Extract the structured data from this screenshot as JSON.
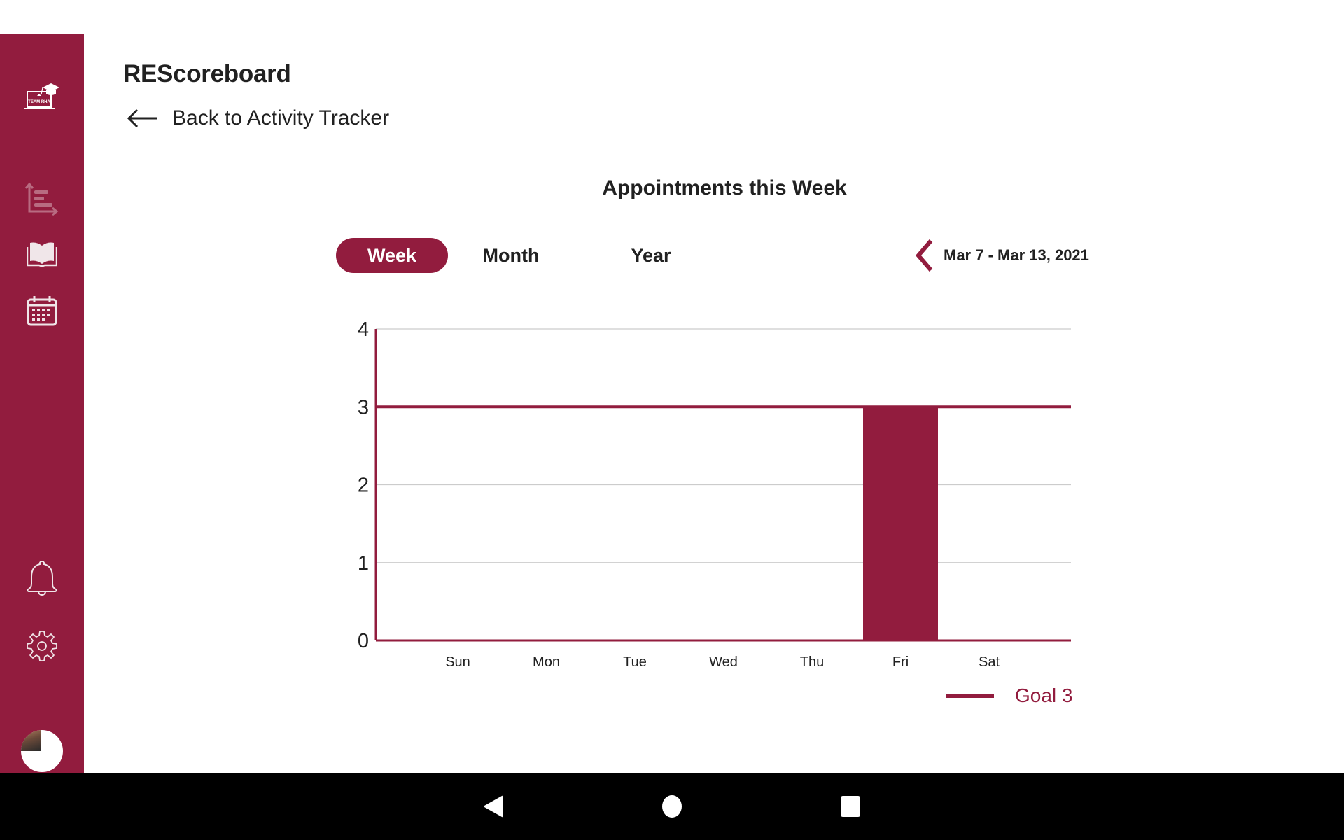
{
  "app": {
    "title": "REScoreboard",
    "back_label": "Back to Activity Tracker"
  },
  "sidebar": {
    "logo": {
      "icon": "team-rha-logo-icon",
      "text": "TEAM RHA"
    },
    "items": [
      {
        "name": "activity-tracker",
        "icon": "chart-bars-icon"
      },
      {
        "name": "resources",
        "icon": "book-icon"
      },
      {
        "name": "calendar",
        "icon": "calendar-icon"
      },
      {
        "name": "notifications",
        "icon": "bell-icon"
      },
      {
        "name": "settings",
        "icon": "gear-icon"
      },
      {
        "name": "profile",
        "icon": "avatar"
      }
    ]
  },
  "view": {
    "tabs": [
      {
        "label": "Week",
        "active": true
      },
      {
        "label": "Month",
        "active": false
      },
      {
        "label": "Year",
        "active": false
      }
    ],
    "date_range": "Mar 7 - Mar 13, 2021",
    "prev_icon": "chevron-left-icon"
  },
  "colors": {
    "accent": "#921c3e",
    "grid": "#cccccc",
    "text": "#212121"
  },
  "chart_data": {
    "type": "bar",
    "title": "Appointments this Week",
    "categories": [
      "Sun",
      "Mon",
      "Tue",
      "Wed",
      "Thu",
      "Fri",
      "Sat"
    ],
    "values": [
      0,
      0,
      0,
      0,
      0,
      3,
      0
    ],
    "ylim": [
      0,
      4
    ],
    "yticks": [
      0,
      1,
      2,
      3,
      4
    ],
    "xlabel": "",
    "ylabel": "",
    "grid": true,
    "goal": {
      "label": "Goal 3",
      "value": 3
    },
    "legend": {
      "entries": [
        "Goal 3"
      ],
      "placement": "bottom-right"
    }
  },
  "navbar": {
    "buttons": [
      "back",
      "home",
      "recents"
    ]
  }
}
